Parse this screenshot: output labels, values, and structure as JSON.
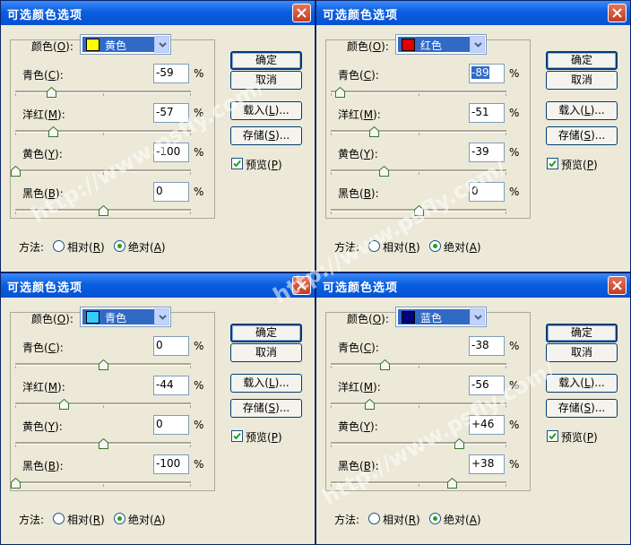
{
  "dialog_title": "可选颜色选项",
  "labels": {
    "color_prefix": "颜色(",
    "color_key": "O",
    "color_suffix": "):",
    "method": "方法:",
    "preview_prefix": "预览(",
    "preview_key": "P",
    "preview_suffix": ")",
    "percent": "%"
  },
  "buttons": {
    "ok": "确定",
    "cancel": "取消",
    "load_prefix": "载入(",
    "load_key": "L",
    "load_suffix": ")...",
    "save_prefix": "存储(",
    "save_key": "S",
    "save_suffix": ")..."
  },
  "slider_labels": [
    {
      "name": "cyan",
      "prefix": "青色(",
      "key": "C",
      "suffix": "):"
    },
    {
      "name": "magenta",
      "prefix": "洋红(",
      "key": "M",
      "suffix": "):"
    },
    {
      "name": "yellow",
      "prefix": "黄色(",
      "key": "Y",
      "suffix": "):"
    },
    {
      "name": "black",
      "prefix": "黑色(",
      "key": "B",
      "suffix": "):"
    }
  ],
  "radios": {
    "relative_prefix": "相对(",
    "relative_key": "R",
    "relative_suffix": ")",
    "absolute_prefix": "绝对(",
    "absolute_key": "A",
    "absolute_suffix": ")"
  },
  "watermark": "http://www.psfly.com/",
  "colors": {
    "title_bar": "#0a5fe0",
    "dialog_bg": "#ece9d8",
    "selection": "#316ac5",
    "close_button": "#c23d20"
  },
  "dialogs": [
    {
      "id": "yellow",
      "color_name": "黄色",
      "swatch": "#ffff00",
      "values": [
        "-59",
        "-57",
        "-100",
        "0"
      ],
      "levels": [
        -59,
        -57,
        -100,
        0
      ],
      "selected_field": -1,
      "preview_checked": true,
      "method": "absolute"
    },
    {
      "id": "red",
      "color_name": "红色",
      "swatch": "#e00000",
      "values": [
        "-89",
        "-51",
        "-39",
        "0"
      ],
      "levels": [
        -89,
        -51,
        -39,
        0
      ],
      "selected_field": 0,
      "preview_checked": true,
      "method": "absolute"
    },
    {
      "id": "cyan",
      "color_name": "青色",
      "swatch": "#33ccff",
      "values": [
        "0",
        "-44",
        "0",
        "-100"
      ],
      "levels": [
        0,
        -44,
        0,
        -100
      ],
      "selected_field": -1,
      "preview_checked": true,
      "method": "absolute"
    },
    {
      "id": "blue",
      "color_name": "蓝色",
      "swatch": "#000080",
      "values": [
        "-38",
        "-56",
        "+46",
        "+38"
      ],
      "levels": [
        -38,
        -56,
        46,
        38
      ],
      "selected_field": -1,
      "preview_checked": true,
      "method": "absolute"
    }
  ]
}
